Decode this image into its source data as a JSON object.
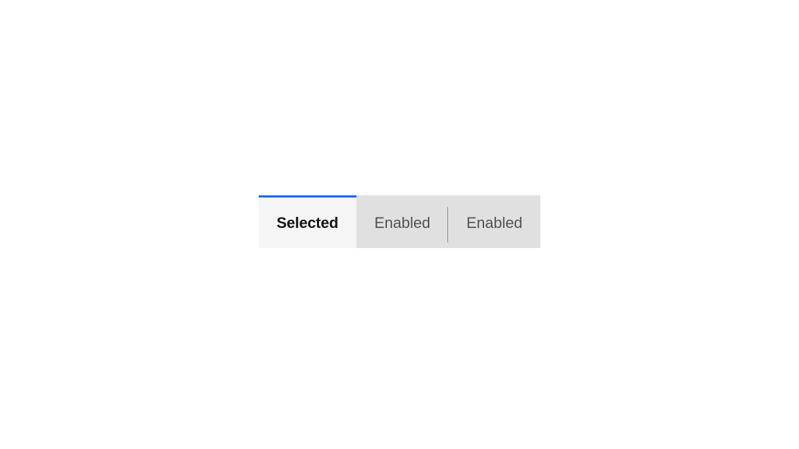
{
  "tabs": [
    {
      "label": "Selected",
      "state": "selected"
    },
    {
      "label": "Enabled",
      "state": "enabled"
    },
    {
      "label": "Enabled",
      "state": "enabled"
    }
  ],
  "colors": {
    "accent": "#0f62fe",
    "selectedBg": "#f5f5f5",
    "enabledBg": "#e0e0e0",
    "selectedText": "#161616",
    "enabledText": "#525252",
    "divider": "#8d8d8d"
  }
}
